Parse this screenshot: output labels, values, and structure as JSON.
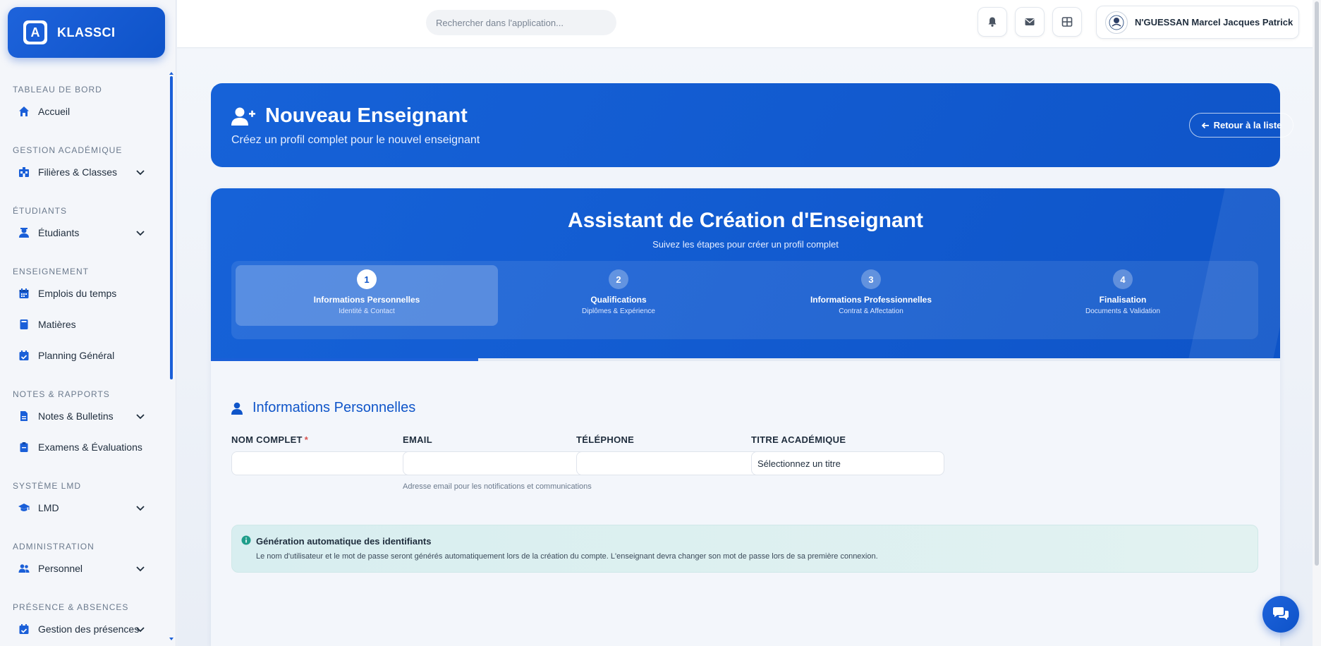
{
  "brand": {
    "name": "KLASSCI",
    "mark": "A"
  },
  "search": {
    "placeholder": "Rechercher dans l'application..."
  },
  "user": {
    "name": "N'GUESSAN Marcel Jacques Patrick"
  },
  "sidebar": {
    "sections": [
      {
        "title": "TABLEAU DE BORD",
        "items": [
          {
            "label": "Accueil",
            "icon": "home-icon",
            "chevron": false
          }
        ]
      },
      {
        "title": "GESTION ACADÉMIQUE",
        "items": [
          {
            "label": "Filières & Classes",
            "icon": "school-icon",
            "chevron": true
          }
        ]
      },
      {
        "title": "ÉTUDIANTS",
        "items": [
          {
            "label": "Étudiants",
            "icon": "student-icon",
            "chevron": true
          }
        ]
      },
      {
        "title": "ENSEIGNEMENT",
        "items": [
          {
            "label": "Emplois du temps",
            "icon": "calendar-icon",
            "chevron": false
          },
          {
            "label": "Matières",
            "icon": "book-icon",
            "chevron": false
          },
          {
            "label": "Planning Général",
            "icon": "calendar-check-icon",
            "chevron": false
          }
        ]
      },
      {
        "title": "NOTES & RAPPORTS",
        "items": [
          {
            "label": "Notes & Bulletins",
            "icon": "file-icon",
            "chevron": true
          },
          {
            "label": "Examens & Évaluations",
            "icon": "clipboard-icon",
            "chevron": false
          }
        ]
      },
      {
        "title": "SYSTÈME LMD",
        "items": [
          {
            "label": "LMD",
            "icon": "graduation-cap-icon",
            "chevron": true
          }
        ]
      },
      {
        "title": "ADMINISTRATION",
        "items": [
          {
            "label": "Personnel",
            "icon": "users-icon",
            "chevron": true
          }
        ]
      },
      {
        "title": "PRÉSENCE & ABSENCES",
        "items": [
          {
            "label": "Gestion des présences",
            "icon": "calendar-check-icon",
            "chevron": true
          }
        ]
      }
    ]
  },
  "hero": {
    "title": "Nouveau Enseignant",
    "subtitle": "Créez un profil complet pour le nouvel enseignant",
    "back_label": "Retour à la liste"
  },
  "wizard": {
    "title": "Assistant de Création d'Enseignant",
    "subtitle": "Suivez les étapes pour créer un profil complet",
    "progress": 0.25,
    "steps": [
      {
        "num": "1",
        "label": "Informations Personnelles",
        "desc": "Identité & Contact",
        "active": true
      },
      {
        "num": "2",
        "label": "Qualifications",
        "desc": "Diplômes & Expérience",
        "active": false
      },
      {
        "num": "3",
        "label": "Informations Professionnelles",
        "desc": "Contrat & Affectation",
        "active": false
      },
      {
        "num": "4",
        "label": "Finalisation",
        "desc": "Documents & Validation",
        "active": false
      }
    ]
  },
  "form": {
    "section_title": "Informations Personnelles",
    "fields": {
      "nom": {
        "label": "NOM COMPLET",
        "required_mark": "*",
        "value": ""
      },
      "email": {
        "label": "EMAIL",
        "value": "",
        "hint": "Adresse email pour les notifications et communications"
      },
      "telephone": {
        "label": "TÉLÉPHONE",
        "value": ""
      },
      "titre": {
        "label": "TITRE ACADÉMIQUE",
        "selected": "Sélectionnez un titre"
      }
    }
  },
  "info": {
    "title": "Génération automatique des identifiants",
    "text": "Le nom d'utilisateur et le mot de passe seront générés automatiquement lors de la création du compte. L'enseignant devra changer son mot de passe lors de sa première connexion."
  },
  "colors": {
    "primary": "#1a5fd8",
    "primary_dark": "#0f55c9",
    "info_bg": "#d8eef0",
    "info_icon": "#1f9d8a"
  }
}
